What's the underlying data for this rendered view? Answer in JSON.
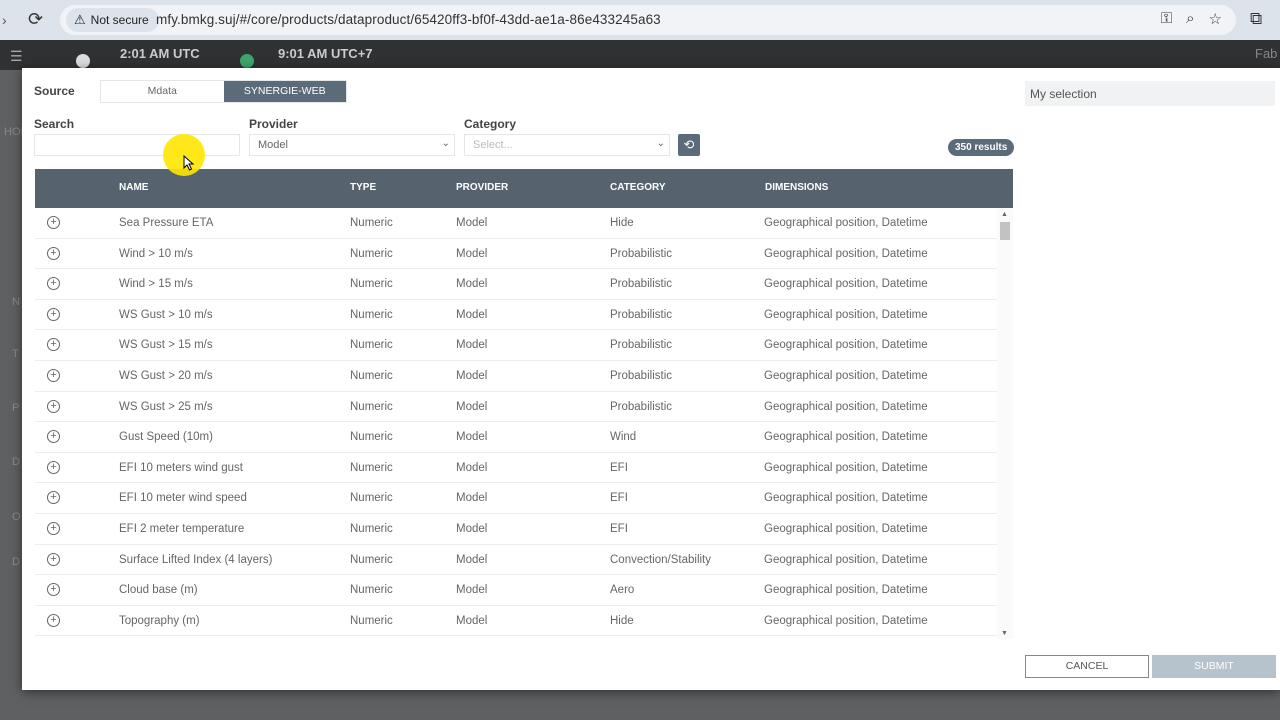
{
  "browser": {
    "security_label": "Not secure",
    "url": "mfy.bmkg.suj/#/core/products/dataproduct/65420ff3-bf0f-43dd-ae1a-86e433245a63"
  },
  "app_bar": {
    "time_utc": "2:01 AM UTC",
    "time_local": "9:01 AM UTC+7",
    "right_text": "Fab",
    "side_letters": [
      "HOM",
      "N",
      "T",
      "P",
      "D",
      "O",
      "D"
    ]
  },
  "modal": {
    "source_label": "Source",
    "source_options": [
      "Mdata",
      "SYNERGIE-WEB"
    ],
    "source_selected": "SYNERGIE-WEB",
    "search_label": "Search",
    "search_value": "",
    "provider_label": "Provider",
    "provider_value": "Model",
    "category_label": "Category",
    "category_placeholder": "Select...",
    "results_count": "350 results",
    "columns": [
      "NAME",
      "TYPE",
      "PROVIDER",
      "CATEGORY",
      "DIMENSIONS"
    ],
    "rows": [
      {
        "name": "Sea Pressure ETA",
        "type": "Numeric",
        "provider": "Model",
        "category": "Hide",
        "dimensions": "Geographical position, Datetime"
      },
      {
        "name": "Wind > 10 m/s",
        "type": "Numeric",
        "provider": "Model",
        "category": "Probabilistic",
        "dimensions": "Geographical position, Datetime"
      },
      {
        "name": "Wind > 15 m/s",
        "type": "Numeric",
        "provider": "Model",
        "category": "Probabilistic",
        "dimensions": "Geographical position, Datetime"
      },
      {
        "name": "WS Gust > 10 m/s",
        "type": "Numeric",
        "provider": "Model",
        "category": "Probabilistic",
        "dimensions": "Geographical position, Datetime"
      },
      {
        "name": "WS Gust > 15 m/s",
        "type": "Numeric",
        "provider": "Model",
        "category": "Probabilistic",
        "dimensions": "Geographical position, Datetime"
      },
      {
        "name": "WS Gust > 20 m/s",
        "type": "Numeric",
        "provider": "Model",
        "category": "Probabilistic",
        "dimensions": "Geographical position, Datetime"
      },
      {
        "name": "WS Gust > 25 m/s",
        "type": "Numeric",
        "provider": "Model",
        "category": "Probabilistic",
        "dimensions": "Geographical position, Datetime"
      },
      {
        "name": "Gust Speed (10m)",
        "type": "Numeric",
        "provider": "Model",
        "category": "Wind",
        "dimensions": "Geographical position, Datetime"
      },
      {
        "name": "EFI 10 meters wind gust",
        "type": "Numeric",
        "provider": "Model",
        "category": "EFI",
        "dimensions": "Geographical position, Datetime"
      },
      {
        "name": "EFI 10 meter wind speed",
        "type": "Numeric",
        "provider": "Model",
        "category": "EFI",
        "dimensions": "Geographical position, Datetime"
      },
      {
        "name": "EFI 2 meter temperature",
        "type": "Numeric",
        "provider": "Model",
        "category": "EFI",
        "dimensions": "Geographical position, Datetime"
      },
      {
        "name": "Surface Lifted Index (4 layers)",
        "type": "Numeric",
        "provider": "Model",
        "category": "Convection/Stability",
        "dimensions": "Geographical position, Datetime"
      },
      {
        "name": "Cloud base (m)",
        "type": "Numeric",
        "provider": "Model",
        "category": "Aero",
        "dimensions": "Geographical position, Datetime"
      },
      {
        "name": "Topography (m)",
        "type": "Numeric",
        "provider": "Model",
        "category": "Hide",
        "dimensions": "Geographical position, Datetime"
      }
    ],
    "my_selection_label": "My selection",
    "cancel_label": "CANCEL",
    "submit_label": "SUBMIT"
  },
  "icons": {
    "add": "add-circle-icon",
    "refresh": "refresh-icon",
    "dropdown": "chevron-down-icon"
  },
  "colors": {
    "header_bg": "#56636e",
    "accent": "#5b6b79",
    "submit_disabled": "#b6c2cc"
  }
}
